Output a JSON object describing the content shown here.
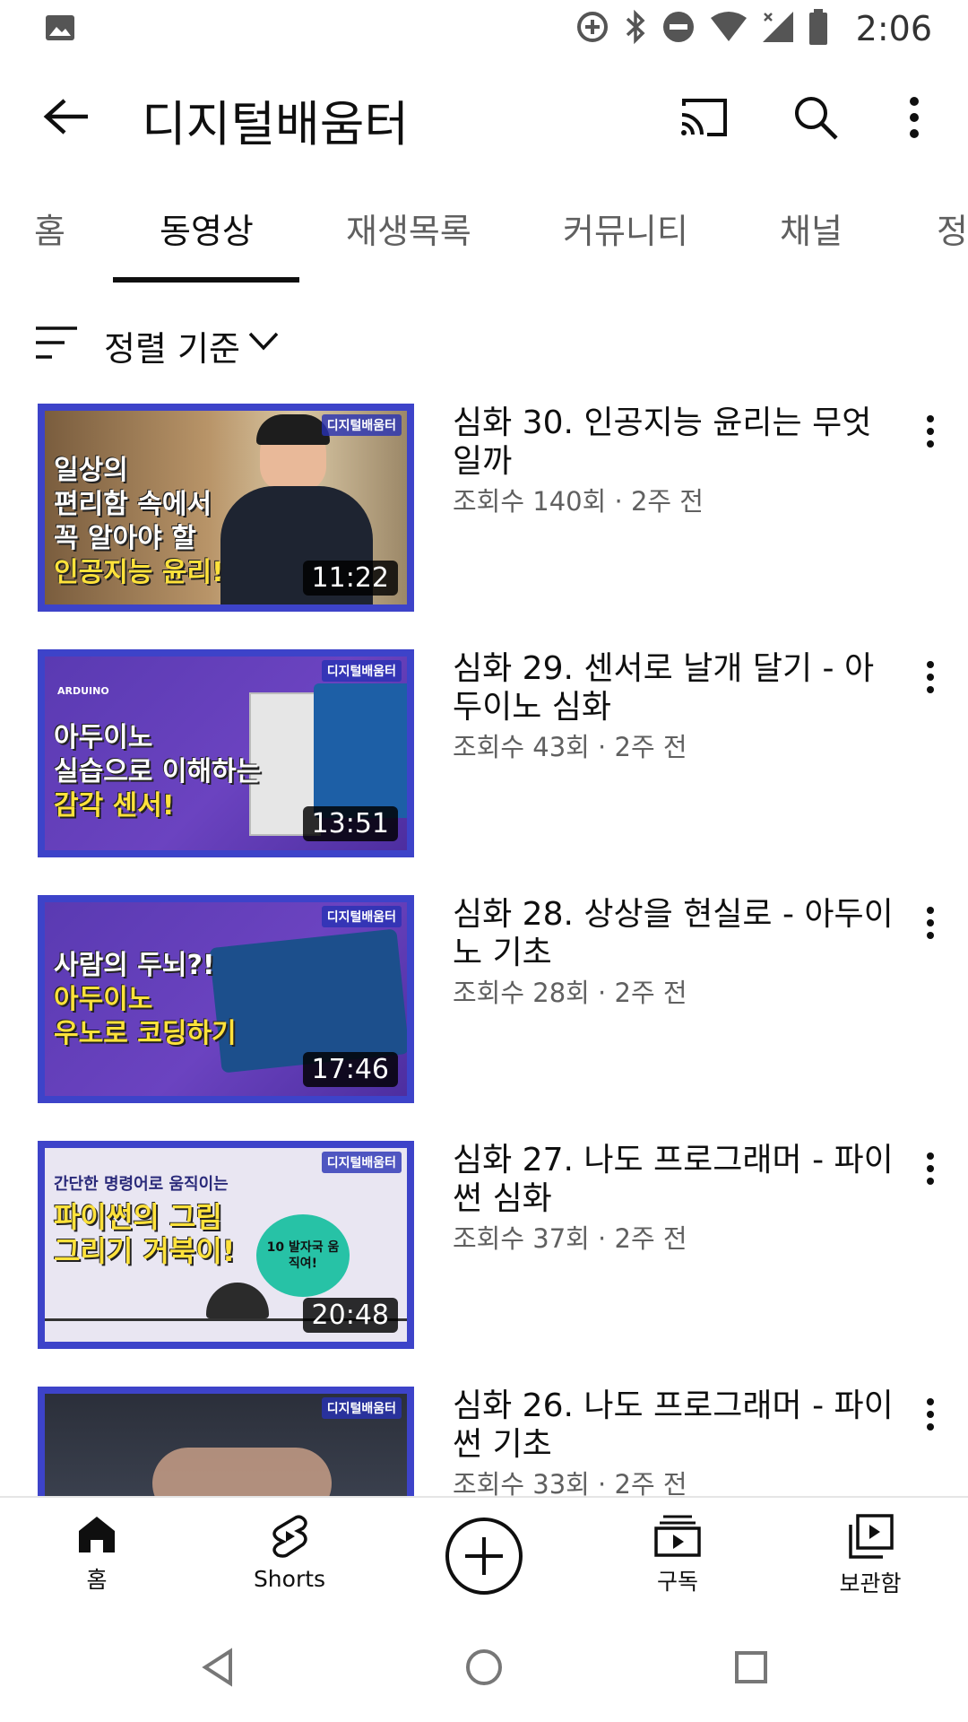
{
  "status_bar": {
    "time": "2:06",
    "icons": [
      "image-icon",
      "data-saver-icon",
      "bluetooth-icon",
      "do-not-disturb-icon",
      "wifi-icon",
      "signal-icon",
      "battery-icon"
    ]
  },
  "app_bar": {
    "title": "디지털배움터",
    "icons": [
      "back-arrow-icon",
      "cast-icon",
      "search-icon",
      "more-vert-icon"
    ]
  },
  "tabs": [
    {
      "label": "홈",
      "active": false
    },
    {
      "label": "동영상",
      "active": true
    },
    {
      "label": "재생목록",
      "active": false
    },
    {
      "label": "커뮤니티",
      "active": false
    },
    {
      "label": "채널",
      "active": false
    },
    {
      "label": "정",
      "active": false
    }
  ],
  "sort": {
    "label": "정렬 기준"
  },
  "videos": [
    {
      "title": "심화 30. 인공지능 윤리는 무엇일까",
      "meta": "조회수 140회 · 2주 전",
      "duration": "11:22",
      "thumb_channel": "디지털배움터",
      "thumb_lines": [
        "일상의",
        "편리함 속에서",
        "꼭 알아야 할",
        "인공지능 윤리!"
      ]
    },
    {
      "title": "심화 29. 센서로 날개 달기 - 아두이노 심화",
      "meta": "조회수 43회 · 2주 전",
      "duration": "13:51",
      "thumb_channel": "디지털배움터",
      "thumb_lines": [
        "ARDUINO",
        "아두이노",
        "실습으로 이해하는",
        "감각 센서!"
      ]
    },
    {
      "title": "심화 28. 상상을 현실로 - 아두이노 기초",
      "meta": "조회수 28회 · 2주 전",
      "duration": "17:46",
      "thumb_channel": "디지털배움터",
      "thumb_lines": [
        "사람의 두뇌?!",
        "아두이노",
        "우노로 코딩하기"
      ]
    },
    {
      "title": "심화 27. 나도 프로그래머 - 파이썬 심화",
      "meta": "조회수 37회 · 2주 전",
      "duration": "20:48",
      "thumb_channel": "디지털배움터",
      "thumb_lines": [
        "간단한 명령어로 움직이는",
        "파이썬의 그림",
        "그리기 거북이!",
        "10 발자국 움직여!"
      ]
    },
    {
      "title": "심화 26. 나도 프로그래머 - 파이썬 기초",
      "meta": "조회수 33회 · 2주 전",
      "duration": "",
      "thumb_channel": "디지털배움터",
      "thumb_lines": []
    }
  ],
  "bottom_nav": [
    {
      "label": "홈",
      "icon": "home-icon"
    },
    {
      "label": "Shorts",
      "icon": "shorts-icon"
    },
    {
      "label": "",
      "icon": "create-plus-icon"
    },
    {
      "label": "구독",
      "icon": "subscriptions-icon"
    },
    {
      "label": "보관함",
      "icon": "library-icon"
    }
  ],
  "system_nav": {
    "icons": [
      "back-triangle-icon",
      "home-circle-icon",
      "recents-square-icon"
    ]
  },
  "colors": {
    "accent_text": "#0f0f0f",
    "secondary_text": "#606060",
    "thumb_border": "#3d43c9"
  }
}
